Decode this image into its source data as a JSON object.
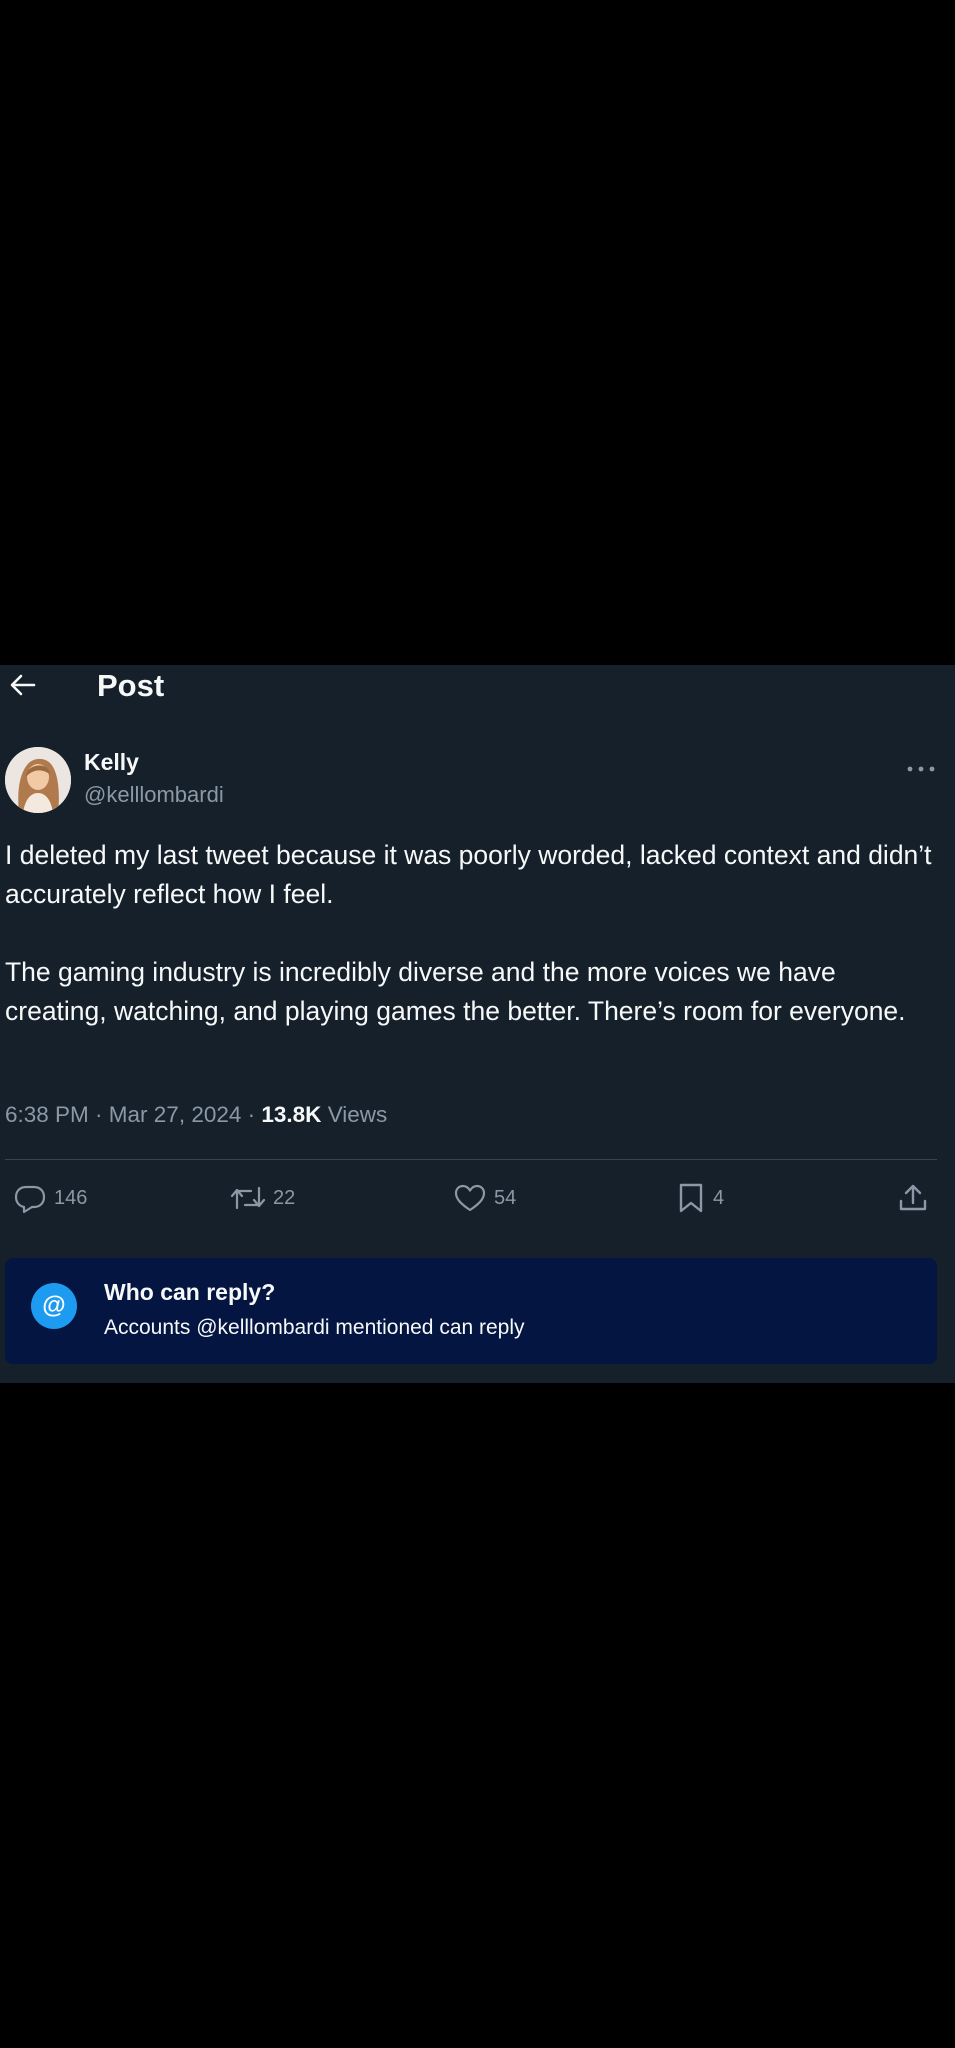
{
  "header": {
    "back_icon": "arrow-left-icon",
    "title": "Post"
  },
  "author": {
    "name": "Kelly",
    "handle": "@kelllombardi",
    "more_icon": "more-horizontal-icon"
  },
  "tweet": {
    "paragraphs": [
      "I deleted my last tweet because it was poorly worded, lacked context and didn’t accurately reflect how I feel.",
      "The gaming industry is incredibly diverse and the more voices we have creating, watching, and playing games the better. There’s room for everyone."
    ],
    "time": "6:38 PM",
    "separator": " · ",
    "date": "Mar 27, 2024",
    "views_count": "13.8K",
    "views_label": " Views"
  },
  "actions": {
    "replies": {
      "icon": "reply-icon",
      "count": "146"
    },
    "reposts": {
      "icon": "repost-icon",
      "count": "22"
    },
    "likes": {
      "icon": "heart-icon",
      "count": "54"
    },
    "bookmarks": {
      "icon": "bookmark-icon",
      "count": "4"
    },
    "share": {
      "icon": "share-icon"
    }
  },
  "who_can_reply": {
    "icon_glyph": "@",
    "title": "Who can reply?",
    "description": "Accounts @kelllombardi mentioned can reply"
  },
  "colors": {
    "background": "#15202b",
    "text_primary": "#f7f9f9",
    "text_secondary": "#8b98a5",
    "accent": "#1d9bf0",
    "reply_card": "#031540"
  }
}
